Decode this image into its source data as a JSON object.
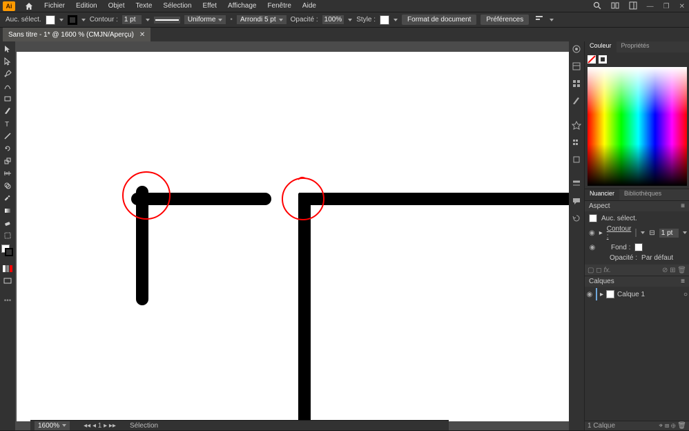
{
  "menu": {
    "items": [
      "Fichier",
      "Edition",
      "Objet",
      "Texte",
      "Sélection",
      "Effet",
      "Affichage",
      "Fenêtre",
      "Aide"
    ],
    "logo": "Ai"
  },
  "windowControls": {
    "min": "—",
    "max": "❐",
    "close": "✕"
  },
  "searchButtons": {
    "search": "search-icon",
    "arrange": "arrange-icon",
    "doc": "doc-icon"
  },
  "ctrl": {
    "noSelect": "Auc. sélect.",
    "strokeLabel": "Contour :",
    "strokeWeight": "1 pt",
    "uniform": "Uniforme",
    "corner": "Arrondi 5 pt",
    "opacityLabel": "Opacité :",
    "opacity": "100%",
    "styleLabel": "Style :",
    "docFormat": "Format de document",
    "prefs": "Préférences"
  },
  "tab": {
    "title": "Sans titre - 1* @ 1600 % (CMJN/Aperçu)",
    "close": "✕"
  },
  "status": {
    "zoom": "1600%",
    "nav": "1",
    "tool": "Sélection"
  },
  "rightPanels": {
    "colorTab": "Couleur",
    "propsTab": "Propriétés",
    "swatchesTab": "Nuancier",
    "libsTab": "Bibliothèques",
    "aspectHdr": "Aspect",
    "noSelect": "Auc. sélect.",
    "contour": "Contour :",
    "contourVal": "1 pt",
    "fond": "Fond :",
    "opac": "Opacité :",
    "opacDefault": "Par défaut",
    "layersHdr": "Calques",
    "layer1": "Calque 1",
    "layerFoot": "1 Calque"
  }
}
